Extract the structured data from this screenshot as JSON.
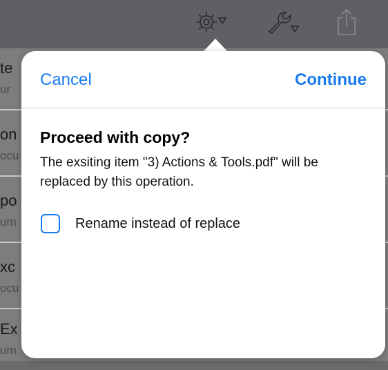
{
  "toolbar": {
    "icons": [
      "gear-dropdown-icon",
      "wrench-dropdown-icon",
      "share-icon"
    ]
  },
  "background_list": {
    "rows": [
      {
        "title": "te",
        "subtitle": "ur"
      },
      {
        "title": "on",
        "subtitle": "ocu"
      },
      {
        "title": "po",
        "subtitle": "um"
      },
      {
        "title": "xc",
        "subtitle": "ocu"
      },
      {
        "title": "Ex",
        "subtitle": "um"
      }
    ]
  },
  "dialog": {
    "cancel_label": "Cancel",
    "continue_label": "Continue",
    "title": "Proceed with copy?",
    "message": "The exsiting item \"3) Actions & Tools.pdf\" will be replaced by this operation.",
    "option_label": "Rename instead of replace",
    "option_checked": false
  },
  "colors": {
    "accent": "#1a7cf0",
    "toolbar_bg": "#5f6064"
  }
}
